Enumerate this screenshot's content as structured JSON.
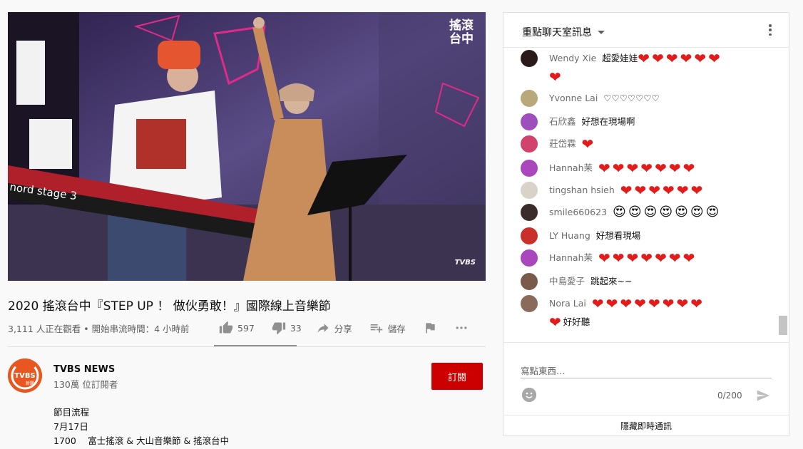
{
  "video": {
    "logo_line1": "搖滾",
    "logo_line2": "台中",
    "watermark": "TVBS",
    "keyboard_label": "nord stage 3"
  },
  "title": "2020 搖滾台中『STEP UP ！ 做伙勇敢！』國際線上音樂節",
  "viewers": "3,111 人正在觀看 • 開始串流時間：4 小時前",
  "actions": {
    "likes": "597",
    "dislikes": "33",
    "share": "分享",
    "save": "儲存"
  },
  "channel": {
    "name": "TVBS NEWS",
    "subscribers": "130萬 位訂閱者",
    "avatar_text": "TVBS",
    "avatar_sub": "新聞",
    "subscribe": "訂閱"
  },
  "description": {
    "line1": "節目流程",
    "line2": "7月17日",
    "line3": "1700　 富士搖滾 & 大山音樂節 & 搖滾台中"
  },
  "chat": {
    "title": "重點聊天室訊息",
    "messages": [
      {
        "author": "Wendy Xie",
        "text": "超愛娃娃",
        "emoji": "heart",
        "count": 6,
        "wrap_emoji": "heart",
        "wrap_count": 1,
        "wrap_text": "",
        "avatar_color": "#2a1a1a"
      },
      {
        "author": "Yvonne Lai",
        "text": "♡♡♡♡♡♡♡",
        "emoji": "",
        "count": 0,
        "avatar_color": "#b8a87a"
      },
      {
        "author": "石欣鑫",
        "text": "好想在現場啊",
        "emoji": "",
        "count": 0,
        "avatar_color": "#9c4fbd"
      },
      {
        "author": "莊岱霖",
        "text": "",
        "emoji": "heart",
        "count": 1,
        "avatar_color": "#d1436c"
      },
      {
        "author": "Hannah茉",
        "text": "",
        "emoji": "heart",
        "count": 7,
        "avatar_color": "#ab47bc"
      },
      {
        "author": "tingshan hsieh",
        "text": "",
        "emoji": "heart",
        "count": 6,
        "avatar_color": "#d8d2c8"
      },
      {
        "author": "smile660623",
        "text": "",
        "emoji": "smiley",
        "count": 7,
        "avatar_color": "#3a2c2a"
      },
      {
        "author": "LY Huang",
        "text": "好想看現場",
        "emoji": "",
        "count": 0,
        "avatar_color": "#c9302c"
      },
      {
        "author": "Hannah茉",
        "text": "",
        "emoji": "heart",
        "count": 7,
        "avatar_color": "#ab47bc"
      },
      {
        "author": "中島愛子",
        "text": "跳起來~~",
        "emoji": "",
        "count": 0,
        "avatar_color": "#7a5a4a"
      },
      {
        "author": "Nora Lai",
        "text": "",
        "emoji": "heart",
        "count": 8,
        "wrap_emoji": "heart",
        "wrap_count": 1,
        "wrap_text": "好好聽",
        "avatar_color": "#8a6a5a"
      }
    ],
    "input_placeholder": "寫點東西…",
    "counter": "0/200",
    "hide_chat": "隱藏即時通訊"
  },
  "colors": {
    "subscribe_bg": "#cc0000",
    "heart": "#e21b1b",
    "muted_text": "#606060"
  },
  "icons": {
    "like": "thumbs-up-icon",
    "dislike": "thumbs-down-icon",
    "share": "share-arrow-icon",
    "save": "playlist-add-icon",
    "flag": "flag-icon",
    "more": "more-horizontal-icon",
    "emoji": "emoji-icon",
    "send": "send-icon"
  }
}
